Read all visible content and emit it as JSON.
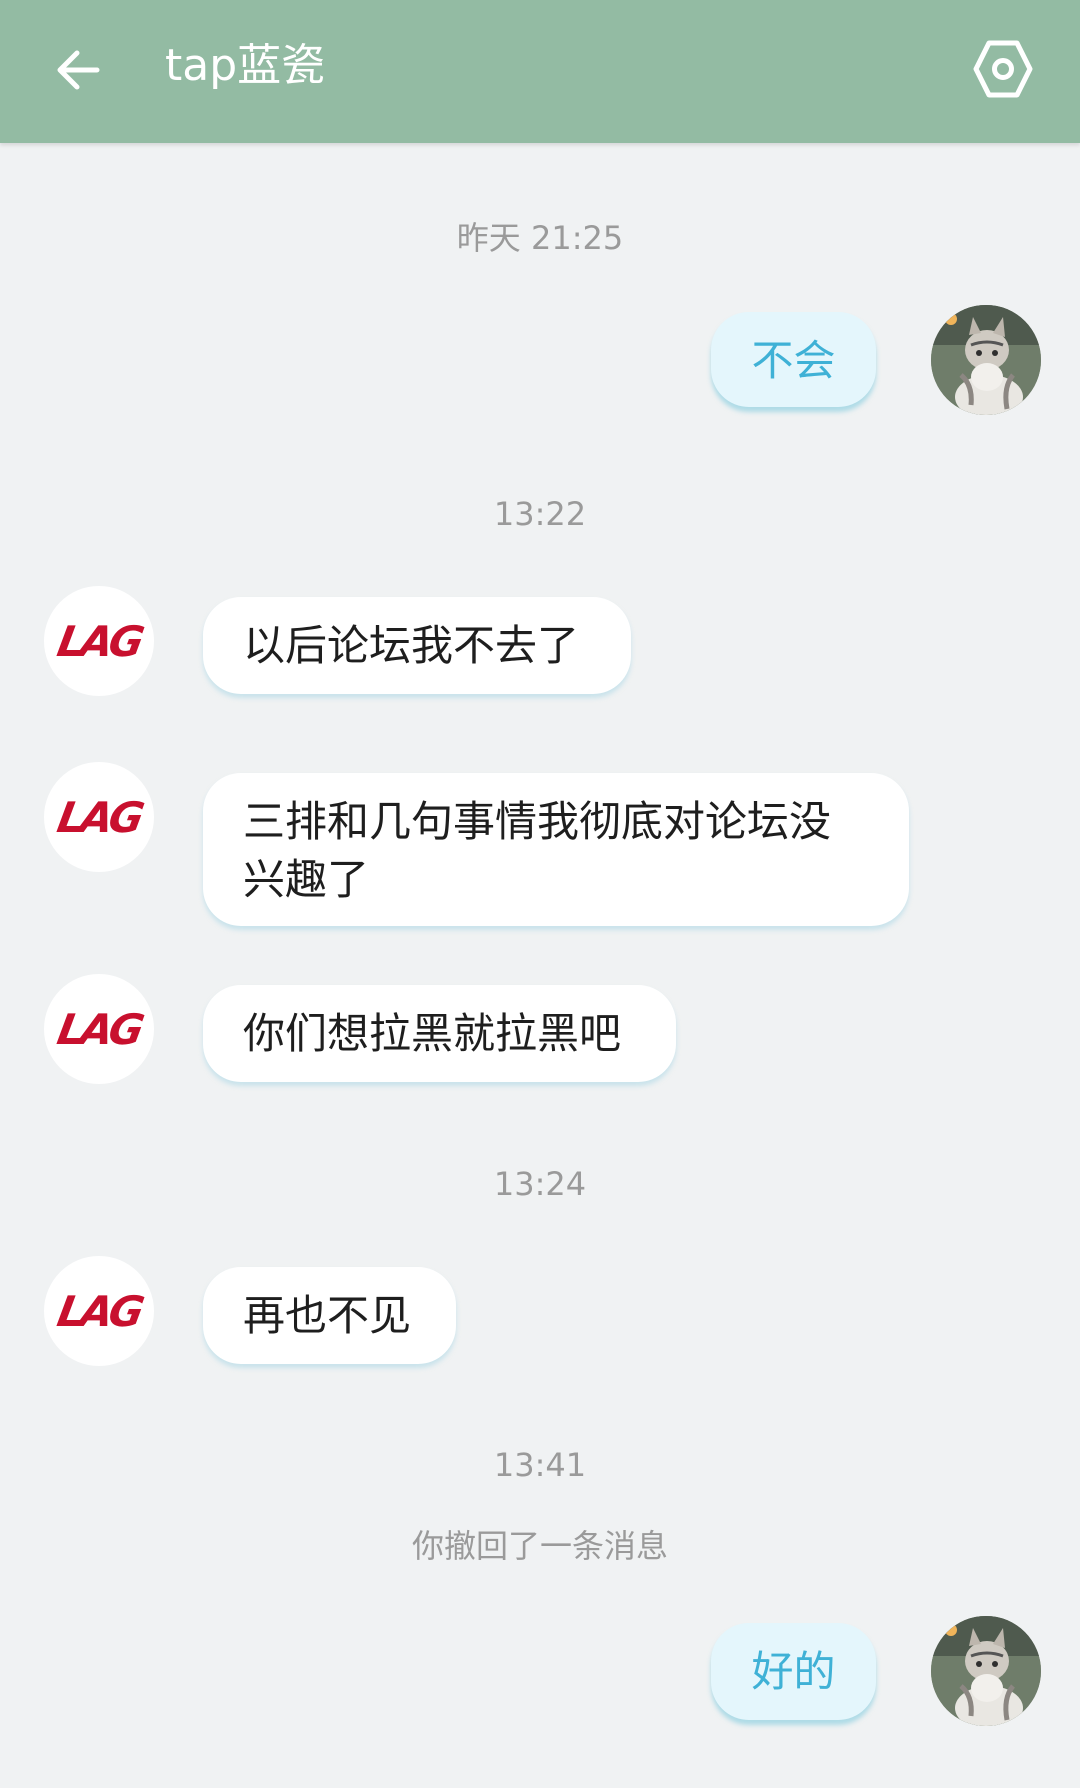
{
  "header": {
    "title": "tap蓝瓷"
  },
  "messages": [
    {
      "type": "time",
      "text": "昨天 21:25"
    },
    {
      "type": "outgoing",
      "text": "不会"
    },
    {
      "type": "time",
      "text": "13:22"
    },
    {
      "type": "incoming",
      "text": "以后论坛我不去了"
    },
    {
      "type": "incoming",
      "text": "三排和几句事情我彻底对论坛没兴趣了"
    },
    {
      "type": "incoming",
      "text": "你们想拉黑就拉黑吧"
    },
    {
      "type": "time",
      "text": "13:24"
    },
    {
      "type": "incoming",
      "text": "再也不见"
    },
    {
      "type": "time",
      "text": "13:41"
    },
    {
      "type": "system",
      "text": "你撤回了一条消息"
    },
    {
      "type": "outgoing",
      "text": "好的"
    }
  ],
  "avatar_logo_text": "LAG",
  "colors": {
    "header_bg": "#93bba3",
    "chat_bg": "#f0f2f3",
    "outgoing_bubble": "#e4f6fc",
    "outgoing_text": "#3fb1d6",
    "logo_red": "#c8102e"
  }
}
